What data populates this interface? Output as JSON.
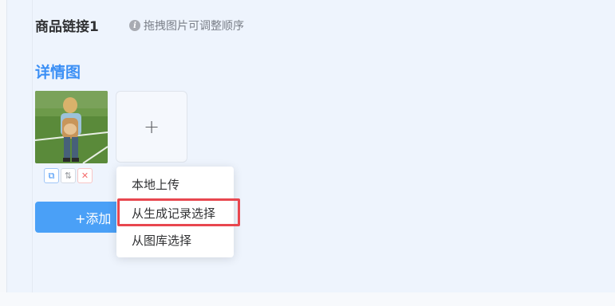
{
  "form": {
    "section_title": "商品链接1",
    "hint": "拖拽图片可调整顺序",
    "detail_title": "详情图",
    "upload_plus": "+",
    "add_button_label": "+添加"
  },
  "thumbnail": {
    "alt": "child with backpack on grass field",
    "actions": [
      {
        "name": "copy-icon",
        "glyph": "⧉"
      },
      {
        "name": "swap-icon",
        "glyph": "⇅"
      },
      {
        "name": "delete-icon",
        "glyph": "✕"
      }
    ]
  },
  "dropdown": {
    "items": [
      {
        "label": "本地上传"
      },
      {
        "label": "从生成记录选择",
        "highlighted": true
      },
      {
        "label": "从图库选择"
      }
    ]
  },
  "colors": {
    "accent": "#3b8ff5",
    "button": "#4aa0f7",
    "highlight_border": "#e8474f",
    "page_bg": "#eef4fd"
  }
}
